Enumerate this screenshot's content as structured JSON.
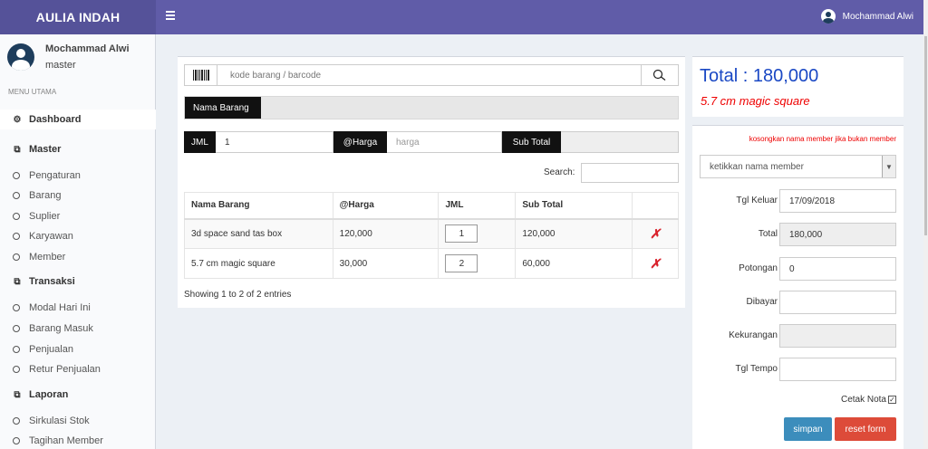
{
  "app": {
    "brand": "AULIA INDAH"
  },
  "header": {
    "user_name": "Mochammad Alwi"
  },
  "sidebar": {
    "user": {
      "name": "Mochammad Alwi",
      "role": "master"
    },
    "menu_header": "MENU UTAMA",
    "dashboard": "Dashboard",
    "sections": [
      {
        "label": "Master",
        "items": [
          "Pengaturan",
          "Barang",
          "Suplier",
          "Karyawan",
          "Member"
        ]
      },
      {
        "label": "Transaksi",
        "items": [
          "Modal Hari Ini",
          "Barang Masuk",
          "Penjualan",
          "Retur Penjualan"
        ]
      },
      {
        "label": "Laporan",
        "items": [
          "Sirkulasi Stok",
          "Tagihan Member"
        ]
      }
    ]
  },
  "pos": {
    "barcode_placeholder": "kode barang / barcode",
    "nama_barang_label": "Nama Barang",
    "jml_label": "JML",
    "jml_value": "1",
    "harga_label": "@Harga",
    "harga_placeholder": "harga",
    "subtotal_label": "Sub Total",
    "search_label": "Search:"
  },
  "table": {
    "columns": [
      "Nama Barang",
      "@Harga",
      "JML",
      "Sub Total"
    ],
    "rows": [
      {
        "nama": "3d space sand tas box",
        "harga": "120,000",
        "jml": "1",
        "subtotal": "120,000"
      },
      {
        "nama": "5.7 cm magic square",
        "harga": "30,000",
        "jml": "2",
        "subtotal": "60,000"
      }
    ],
    "info": "Showing 1 to 2 of 2 entries"
  },
  "summary": {
    "total": "Total : 180,000",
    "last_item": "5.7 cm magic square"
  },
  "form": {
    "hint": "kosongkan nama member jika bukan member",
    "member_placeholder": "ketikkan nama member",
    "fields": [
      {
        "label": "Tgl Keluar",
        "value": "17/09/2018",
        "readonly": false
      },
      {
        "label": "Total",
        "value": "180,000",
        "readonly": true
      },
      {
        "label": "Potongan",
        "value": "0",
        "readonly": false
      },
      {
        "label": "Dibayar",
        "value": "",
        "readonly": false
      },
      {
        "label": "Kekurangan",
        "value": "",
        "readonly": true
      },
      {
        "label": "Tgl Tempo",
        "value": "",
        "readonly": false
      }
    ],
    "cetak_nota": "Cetak Nota",
    "btn_simpan": "simpan",
    "btn_reset": "reset form"
  },
  "colors": {
    "header": "#605ca8",
    "logo": "#555299",
    "total_text": "#1a48c4",
    "hint": "#ee0000",
    "simpan": "#3c8dbc",
    "reset": "#dd4b39"
  },
  "icons": {
    "barcode": "barcode-icon",
    "search": "search-icon",
    "delete": "delete-icon",
    "menu": "hamburger-icon",
    "user": "user-icon"
  }
}
